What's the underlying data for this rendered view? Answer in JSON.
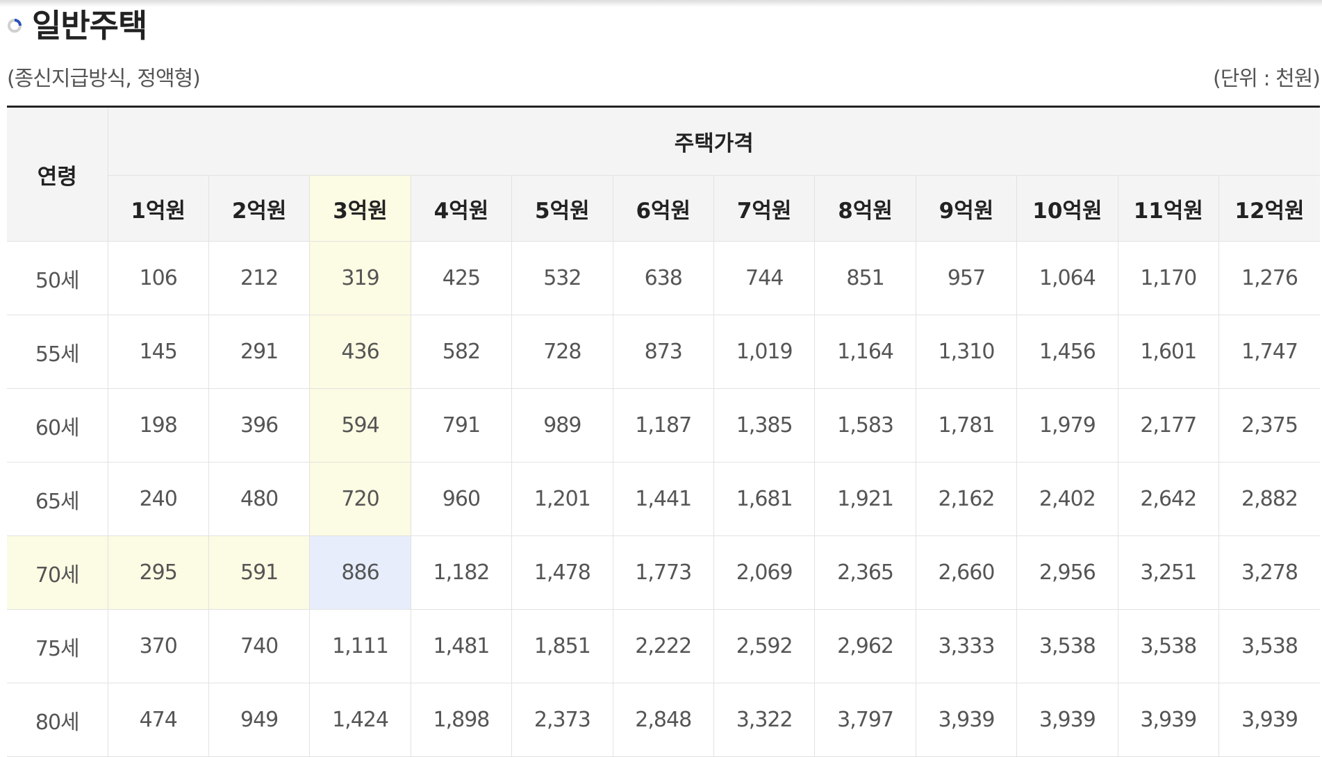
{
  "page": {
    "title": "일반주택",
    "subtitle": "(종신지급방식, 정액형)",
    "unit": "(단위 : 천원)",
    "title_icon": "ring-bullet-icon",
    "colors": {
      "highlight": "#fcfbe3",
      "selected": "#e7edfb",
      "header_bg": "#f4f4f4",
      "icon_blue": "#2a52be"
    }
  },
  "table": {
    "age_header": "연령",
    "price_header": "주택가격",
    "price_columns": [
      "1억원",
      "2억원",
      "3억원",
      "4억원",
      "5억원",
      "6억원",
      "7억원",
      "8억원",
      "9억원",
      "10억원",
      "11억원",
      "12억원"
    ],
    "rows": [
      {
        "age": "50세",
        "values": [
          "106",
          "212",
          "319",
          "425",
          "532",
          "638",
          "744",
          "851",
          "957",
          "1,064",
          "1,170",
          "1,276"
        ]
      },
      {
        "age": "55세",
        "values": [
          "145",
          "291",
          "436",
          "582",
          "728",
          "873",
          "1,019",
          "1,164",
          "1,310",
          "1,456",
          "1,601",
          "1,747"
        ]
      },
      {
        "age": "60세",
        "values": [
          "198",
          "396",
          "594",
          "791",
          "989",
          "1,187",
          "1,385",
          "1,583",
          "1,781",
          "1,979",
          "2,177",
          "2,375"
        ]
      },
      {
        "age": "65세",
        "values": [
          "240",
          "480",
          "720",
          "960",
          "1,201",
          "1,441",
          "1,681",
          "1,921",
          "2,162",
          "2,402",
          "2,642",
          "2,882"
        ]
      },
      {
        "age": "70세",
        "values": [
          "295",
          "591",
          "886",
          "1,182",
          "1,478",
          "1,773",
          "2,069",
          "2,365",
          "2,660",
          "2,956",
          "3,251",
          "3,278"
        ]
      },
      {
        "age": "75세",
        "values": [
          "370",
          "740",
          "1,111",
          "1,481",
          "1,851",
          "2,222",
          "2,592",
          "2,962",
          "3,333",
          "3,538",
          "3,538",
          "3,538"
        ]
      },
      {
        "age": "80세",
        "values": [
          "474",
          "949",
          "1,424",
          "1,898",
          "2,373",
          "2,848",
          "3,322",
          "3,797",
          "3,939",
          "3,939",
          "3,939",
          "3,939"
        ]
      }
    ],
    "highlight": {
      "column": "3억원",
      "row": "70세",
      "selected_cell": {
        "age": "70세",
        "price": "3억원"
      }
    }
  }
}
